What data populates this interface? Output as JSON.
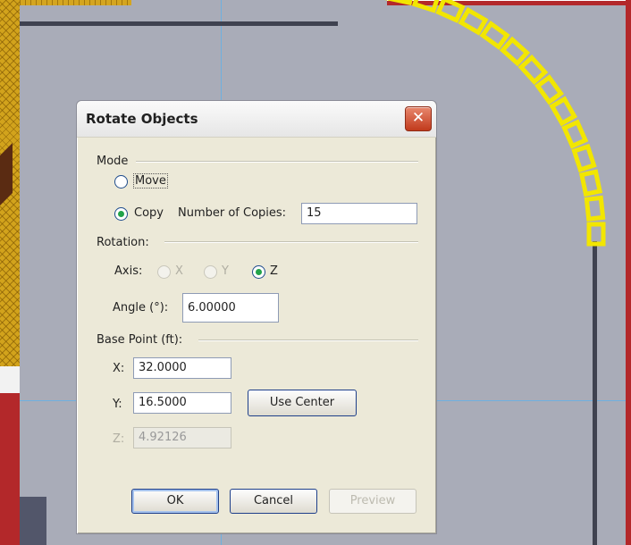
{
  "background": {
    "accent_yellow": "#f2e600",
    "wall_color": "#3f4250",
    "guide_color": "#6fb0e0",
    "copy_count": 16
  },
  "dialog": {
    "title": "Rotate Objects",
    "close_icon": "close-icon",
    "mode": {
      "label": "Mode",
      "move_label": "Move",
      "copy_label": "Copy",
      "selected": "Copy",
      "copies_label": "Number of Copies:",
      "copies_value": "15"
    },
    "rotation": {
      "label": "Rotation:",
      "axis_label": "Axis:",
      "axis_options": [
        "X",
        "Y",
        "Z"
      ],
      "axis_selected": "Z",
      "angle_label": "Angle (°):",
      "angle_value": "6.00000"
    },
    "base_point": {
      "label": "Base Point (ft):",
      "x_label": "X:",
      "x_value": "32.0000",
      "y_label": "Y:",
      "y_value": "16.5000",
      "z_label": "Z:",
      "z_value": "4.92126",
      "use_center_label": "Use Center"
    },
    "buttons": {
      "ok": "OK",
      "cancel": "Cancel",
      "preview": "Preview"
    }
  }
}
